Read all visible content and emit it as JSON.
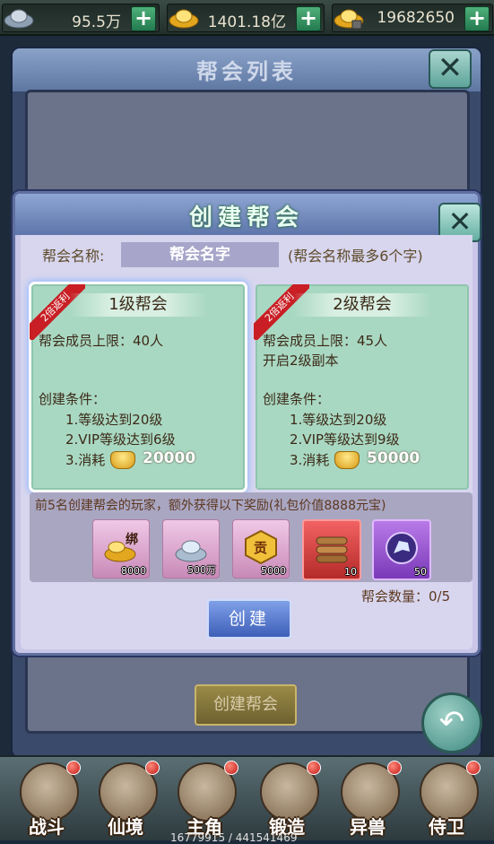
{
  "currency": [
    {
      "icon": "silver-ingot-icon",
      "value": "95.5万"
    },
    {
      "icon": "gold-ingot-icon",
      "value": "1401.18亿"
    },
    {
      "icon": "locked-gold-ingot-icon",
      "value": "19682650"
    }
  ],
  "background_panel": {
    "title": "帮会列表",
    "create_button": "创建帮会"
  },
  "dialog": {
    "title": "创建帮会",
    "name_label": "帮会名称:",
    "name_input_value": "帮会名字",
    "name_hint": "(帮会名称最多6个字)",
    "levels": [
      {
        "ribbon": "2倍返利",
        "title": "1级帮会",
        "lines": [
          "帮会成员上限：40人",
          ""
        ],
        "cond_header": "创建条件：",
        "conds": [
          "1.等级达到20级",
          "2.VIP等级达到6级"
        ],
        "cost_label": "3.消耗",
        "cost": "20000"
      },
      {
        "ribbon": "2倍返利",
        "title": "2级帮会",
        "lines": [
          "帮会成员上限：45人",
          "开启2级副本"
        ],
        "cond_header": "创建条件：",
        "conds": [
          "1.等级达到20级",
          "2.VIP等级达到9级"
        ],
        "cost_label": "3.消耗",
        "cost": "50000"
      }
    ],
    "reward_text": "前5名创建帮会的玩家，额外获得以下奖励(礼包价值8888元宝)",
    "rewards": [
      {
        "icon": "bound-gold-pile-icon",
        "count": "8000",
        "badge": "绑"
      },
      {
        "icon": "silver-pile-icon",
        "count": "500万"
      },
      {
        "icon": "contribution-token-icon",
        "count": "5000",
        "badge": "贡"
      },
      {
        "icon": "wood-logs-icon",
        "count": "10"
      },
      {
        "icon": "purple-horse-orb-icon",
        "count": "50"
      }
    ],
    "guild_count": "帮会数量：0/5",
    "create_button": "创建"
  },
  "bottom_nav": [
    {
      "label": "战斗",
      "badge": true
    },
    {
      "label": "仙境",
      "badge": true
    },
    {
      "label": "主角",
      "badge": true
    },
    {
      "label": "锻造",
      "badge": true
    },
    {
      "label": "异兽",
      "badge": true
    },
    {
      "label": "侍卫",
      "badge": true
    }
  ],
  "bottom_overflow_text": "16779915 / 441541469"
}
